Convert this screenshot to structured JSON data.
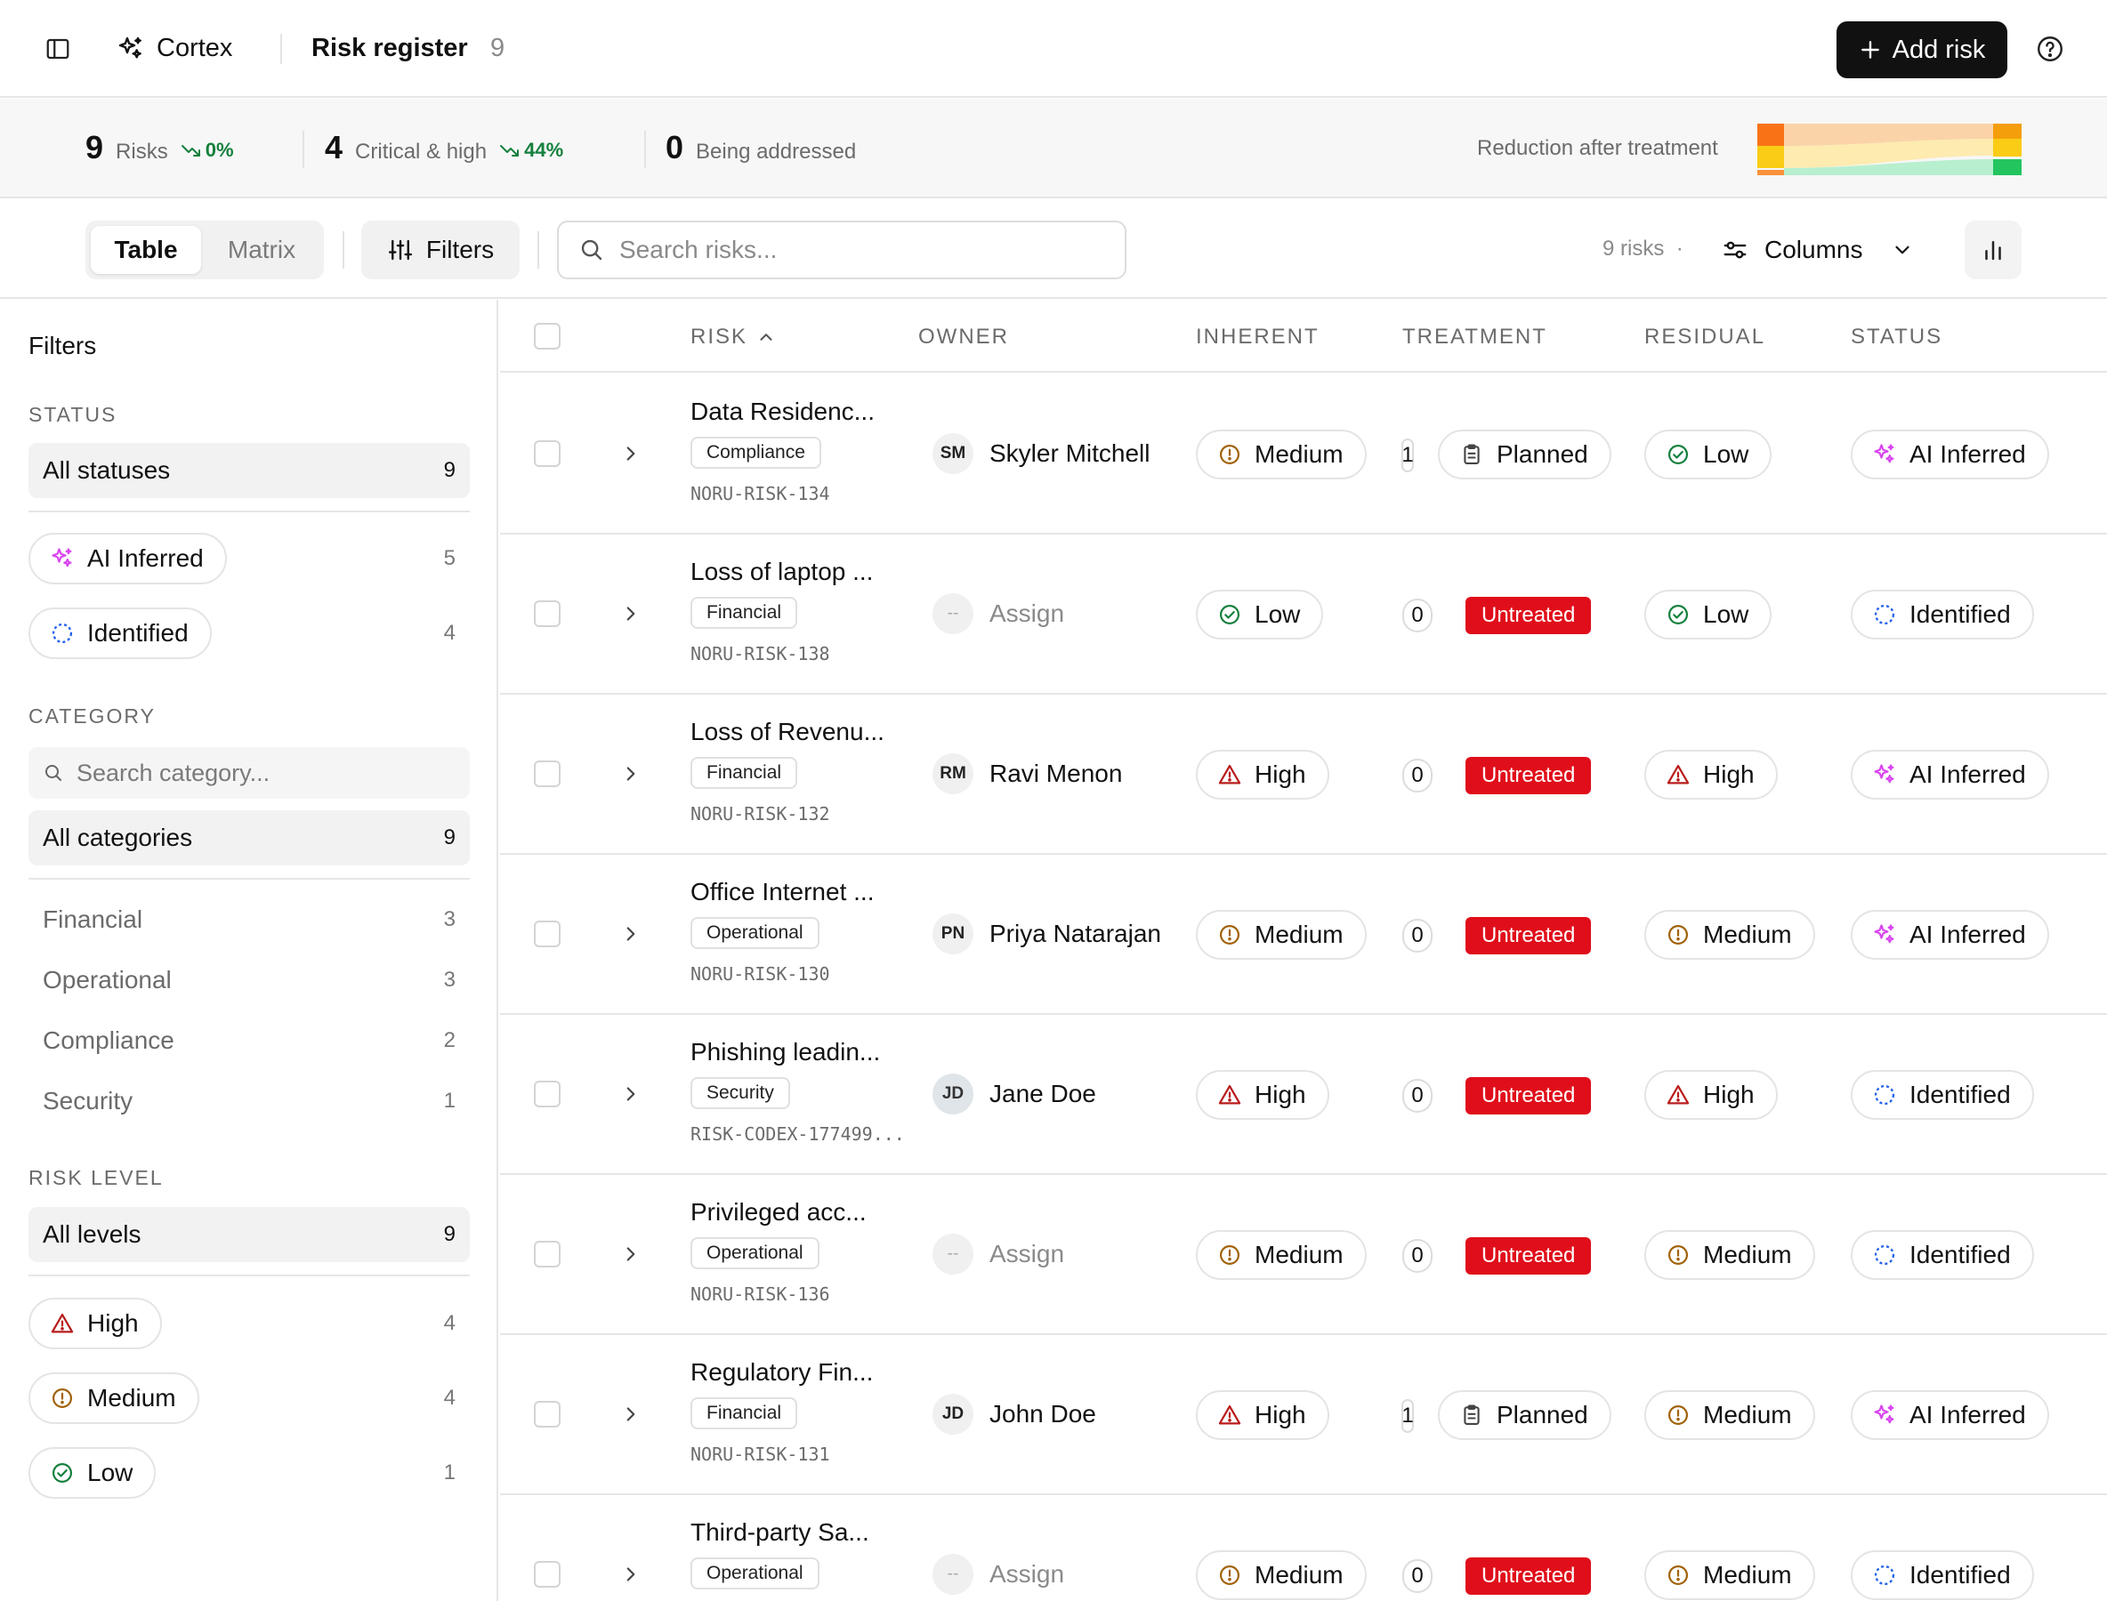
{
  "topbar": {
    "app_name": "Cortex",
    "page_title": "Risk register",
    "page_count": "9",
    "add_button": "Add risk"
  },
  "stats": {
    "risks": {
      "value": "9",
      "label": "Risks",
      "trend": "0%"
    },
    "critical": {
      "value": "4",
      "label": "Critical & high",
      "trend": "44%"
    },
    "addressed": {
      "value": "0",
      "label": "Being addressed"
    },
    "reduction_label": "Reduction after treatment"
  },
  "toolbar": {
    "view_table": "Table",
    "view_matrix": "Matrix",
    "filters": "Filters",
    "search_placeholder": "Search risks...",
    "risk_count": "9 risks",
    "risk_count_sep": "·",
    "columns": "Columns"
  },
  "sidebar": {
    "title": "Filters",
    "status_heading": "STATUS",
    "status_all": {
      "label": "All statuses",
      "count": "9"
    },
    "statuses": [
      {
        "label": "AI Inferred",
        "count": "5",
        "icon": "sparkle-icon"
      },
      {
        "label": "Identified",
        "count": "4",
        "icon": "dashed-circle-icon"
      }
    ],
    "category_heading": "CATEGORY",
    "category_search_placeholder": "Search category...",
    "category_all": {
      "label": "All categories",
      "count": "9"
    },
    "categories": [
      {
        "label": "Financial",
        "count": "3"
      },
      {
        "label": "Operational",
        "count": "3"
      },
      {
        "label": "Compliance",
        "count": "2"
      },
      {
        "label": "Security",
        "count": "1"
      }
    ],
    "level_heading": "RISK LEVEL",
    "level_all": {
      "label": "All levels",
      "count": "9"
    },
    "levels": [
      {
        "label": "High",
        "count": "4",
        "icon": "warning-triangle-icon"
      },
      {
        "label": "Medium",
        "count": "4",
        "icon": "alert-circle-icon"
      },
      {
        "label": "Low",
        "count": "1",
        "icon": "check-circle-icon"
      }
    ]
  },
  "table": {
    "columns": [
      "RISK",
      "OWNER",
      "INHERENT",
      "TREATMENT",
      "RESIDUAL",
      "STATUS"
    ],
    "rows": [
      {
        "title": "Data Residenc...",
        "category": "Compliance",
        "id": "NORU-RISK-134",
        "owner_initials": "SM",
        "owner": "Skyler Mitchell",
        "inherent": "Medium",
        "treatment_count": "1",
        "treatment": "Planned",
        "residual": "Low",
        "status": "AI Inferred"
      },
      {
        "title": "Loss of laptop ...",
        "category": "Financial",
        "id": "NORU-RISK-138",
        "owner_initials": "--",
        "owner": "Assign",
        "inherent": "Low",
        "treatment_count": "0",
        "treatment": "Untreated",
        "residual": "Low",
        "status": "Identified"
      },
      {
        "title": "Loss of Revenu...",
        "category": "Financial",
        "id": "NORU-RISK-132",
        "owner_initials": "RM",
        "owner": "Ravi Menon",
        "inherent": "High",
        "treatment_count": "0",
        "treatment": "Untreated",
        "residual": "High",
        "status": "AI Inferred"
      },
      {
        "title": "Office Internet ...",
        "category": "Operational",
        "id": "NORU-RISK-130",
        "owner_initials": "PN",
        "owner": "Priya Natarajan",
        "inherent": "Medium",
        "treatment_count": "0",
        "treatment": "Untreated",
        "residual": "Medium",
        "status": "AI Inferred"
      },
      {
        "title": "Phishing leadin...",
        "category": "Security",
        "id": "RISK-CODEX-177499...",
        "owner_initials": "JD",
        "owner": "Jane Doe",
        "inherent": "High",
        "treatment_count": "0",
        "treatment": "Untreated",
        "residual": "High",
        "status": "Identified"
      },
      {
        "title": "Privileged acc...",
        "category": "Operational",
        "id": "NORU-RISK-136",
        "owner_initials": "--",
        "owner": "Assign",
        "inherent": "Medium",
        "treatment_count": "0",
        "treatment": "Untreated",
        "residual": "Medium",
        "status": "Identified"
      },
      {
        "title": "Regulatory Fin...",
        "category": "Financial",
        "id": "NORU-RISK-131",
        "owner_initials": "JD",
        "owner": "John Doe",
        "inherent": "High",
        "treatment_count": "1",
        "treatment": "Planned",
        "residual": "Medium",
        "status": "AI Inferred"
      },
      {
        "title": "Third-party Sa...",
        "category": "Operational",
        "id": "",
        "owner_initials": "--",
        "owner": "Assign",
        "inherent": "Medium",
        "treatment_count": "0",
        "treatment": "Untreated",
        "residual": "Medium",
        "status": "Identified"
      }
    ]
  },
  "colors": {
    "high": "#b91c1c",
    "medium": "#a16207",
    "low": "#15803d",
    "ai_inferred": "#d946ef",
    "identified": "#2563eb",
    "untreated": "#e00e1a",
    "trend": "#15803d"
  }
}
